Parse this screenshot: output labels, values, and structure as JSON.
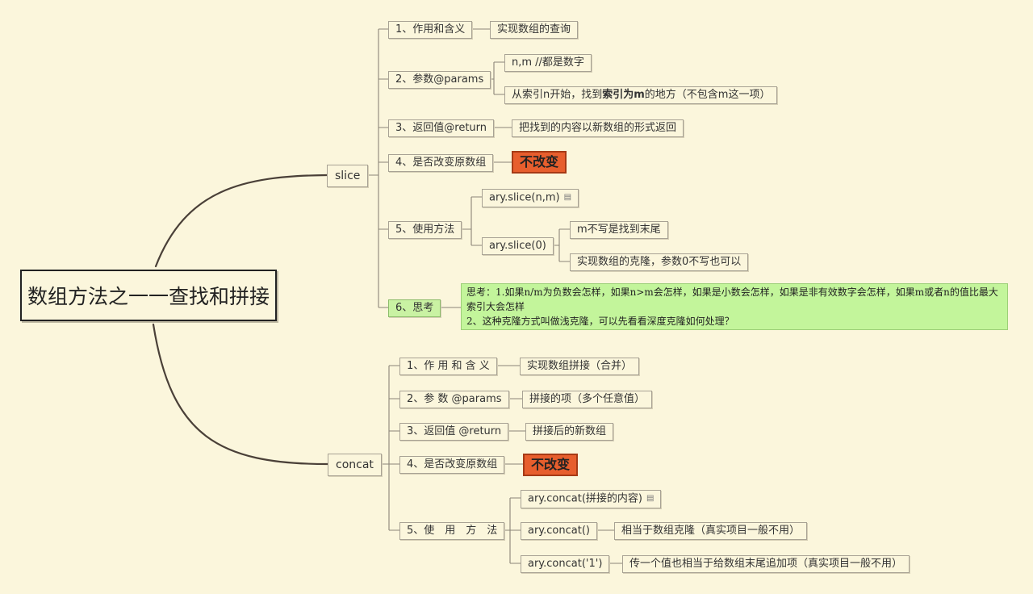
{
  "root": {
    "title": "数组方法之一一查找和拼接"
  },
  "slice": {
    "label": "slice",
    "items": [
      {
        "label": "1、作用和含义",
        "values": [
          "实现数组的查询"
        ]
      },
      {
        "label": "2、参数@params",
        "values": [
          "n,m  //都是数字"
        ],
        "desc": {
          "pre": "从索引n开始，找到",
          "bold": "索引为m",
          "post": "的地方（不包含m这一项）"
        }
      },
      {
        "label": "3、返回值@return",
        "values": [
          "把找到的内容以新数组的形式返回"
        ]
      },
      {
        "label": "4、是否改变原数组",
        "badge": "不改变"
      },
      {
        "label": "5、使用方法",
        "usage": [
          {
            "code": "ary.slice(n,m)"
          },
          {
            "code": "ary.slice(0)",
            "notes": [
              "m不写是找到末尾",
              "实现数组的克隆，参数0不写也可以"
            ]
          }
        ]
      },
      {
        "label": "6、思考",
        "note": {
          "line1": "思考：1.如果n/m为负数会怎样，如果n>m会怎样，如果是小数会怎样，如果是非有效数字会怎样，如果m或者n的值比最大索引大会怎样",
          "line2": "2、这种克隆方式叫做浅克隆，可以先看看深度克隆如何处理？"
        }
      }
    ]
  },
  "concat": {
    "label": "concat",
    "items": [
      {
        "label": "1、作 用 和 含 义",
        "values": [
          "实现数组拼接（合并）"
        ]
      },
      {
        "label": "2、参 数 @params",
        "values": [
          "拼接的项（多个任意值）"
        ]
      },
      {
        "label": "3、返回值 @return",
        "values": [
          "拼接后的新数组"
        ]
      },
      {
        "label": "4、是否改变原数组",
        "badge": "不改变"
      },
      {
        "label": "5、使　用　方　法",
        "usage": [
          {
            "code": "ary.concat(拼接的内容)"
          },
          {
            "code": "ary.concat()",
            "note": "相当于数组克隆（真实项目一般不用）"
          },
          {
            "code": "ary.concat('1')",
            "note": "传一个值也相当于给数组末尾追加项（真实项目一般不用）"
          }
        ]
      }
    ]
  },
  "icons": {
    "attachment": "note-attachment-icon"
  },
  "colors": {
    "background": "#fbf6dc",
    "badge": "#e75e2d",
    "note": "#c3f59b",
    "highlight": "#c9f2a3"
  }
}
